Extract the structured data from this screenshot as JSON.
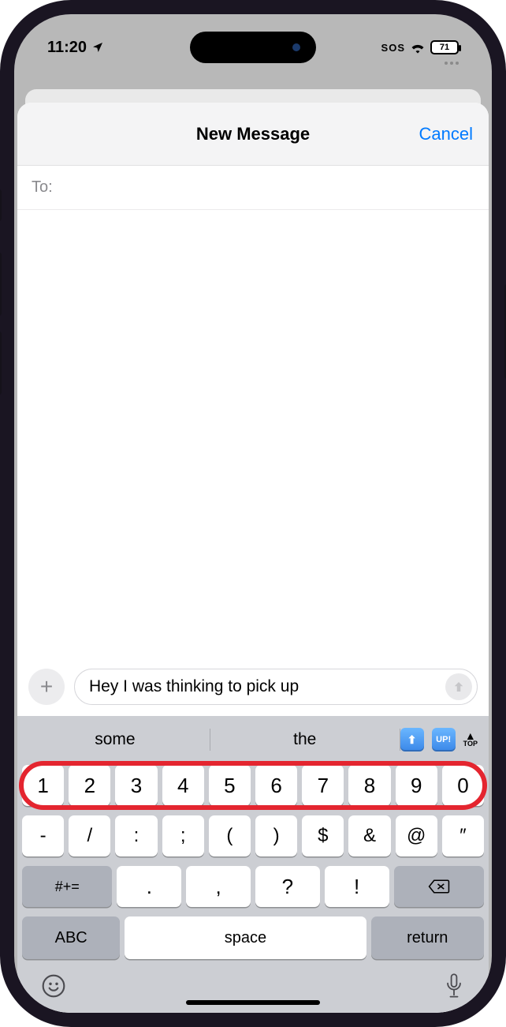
{
  "status": {
    "time": "11:20",
    "sos": "SOS",
    "battery": "71"
  },
  "sheet": {
    "title": "New Message",
    "cancel": "Cancel",
    "to_label": "To:"
  },
  "compose": {
    "text": "Hey I was thinking to pick up"
  },
  "suggestions": {
    "a": "some",
    "b": "the",
    "up_label": "UP!",
    "top_label": "TOP"
  },
  "keys": {
    "num": [
      "1",
      "2",
      "3",
      "4",
      "5",
      "6",
      "7",
      "8",
      "9",
      "0"
    ],
    "sym": [
      "-",
      "/",
      ":",
      ";",
      "(",
      ")",
      "$",
      "&",
      "@",
      "″"
    ],
    "row3_special": "#+=",
    "row3": [
      ".",
      ",",
      "?",
      "!"
    ],
    "abc": "ABC",
    "space": "space",
    "return": "return"
  }
}
